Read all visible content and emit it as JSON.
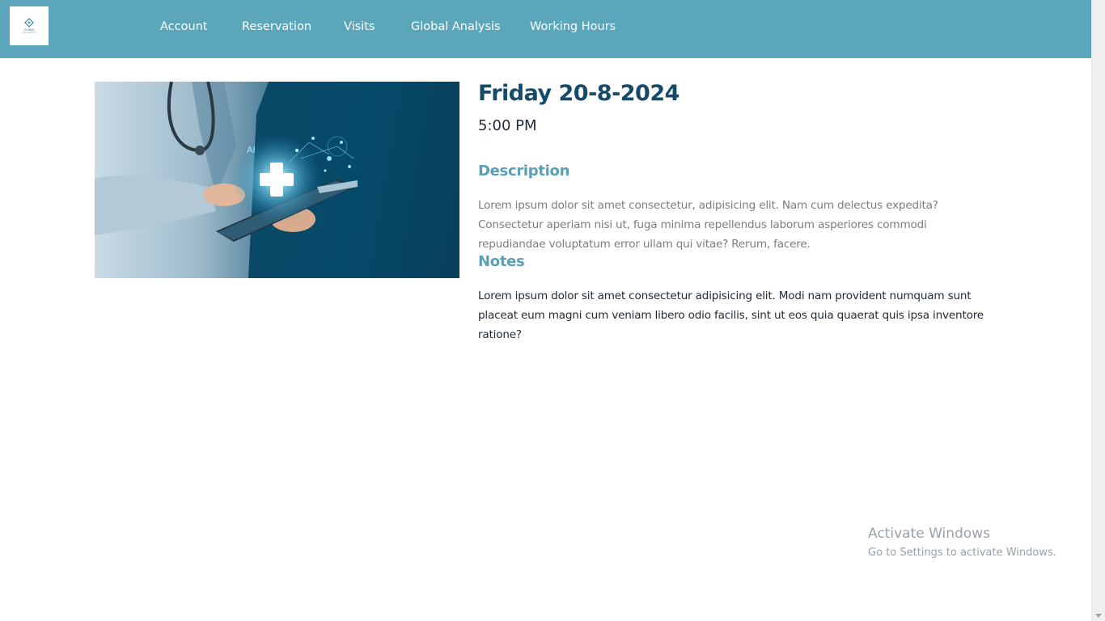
{
  "nav": {
    "logo_text": "CLINIC",
    "logo_subtext": "your health first",
    "items": [
      {
        "label": "Account"
      },
      {
        "label": "Reservation"
      },
      {
        "label": "Visits"
      },
      {
        "label": "Global Analysis"
      },
      {
        "label": "Working Hours"
      }
    ]
  },
  "hero": {
    "ai_label": "AI"
  },
  "appointment": {
    "date": "Friday 20-8-2024",
    "time": "5:00 PM",
    "description_heading": "Description",
    "description": "Lorem ipsum dolor sit amet consectetur, adipisicing elit. Nam cum delectus expedita? Consectetur aperiam nisi ut, fuga minima repellendus laborum asperiores commodi repudiandae voluptatum error ullam qui vitae? Rerum, facere.",
    "notes_heading": "Notes",
    "notes": "Lorem ipsum dolor sit amet consectetur adipisicing elit. Modi nam provident numquam sunt placeat eum magni cum veniam libero odio facilis, sint ut eos quia quaerat quis ipsa inventore ratione?"
  },
  "watermark": {
    "title": "Activate Windows",
    "subtitle": "Go to Settings to activate Windows."
  },
  "colors": {
    "navbar": "#5ba6bb",
    "title": "#164a6a",
    "heading": "#5a9fb7"
  }
}
